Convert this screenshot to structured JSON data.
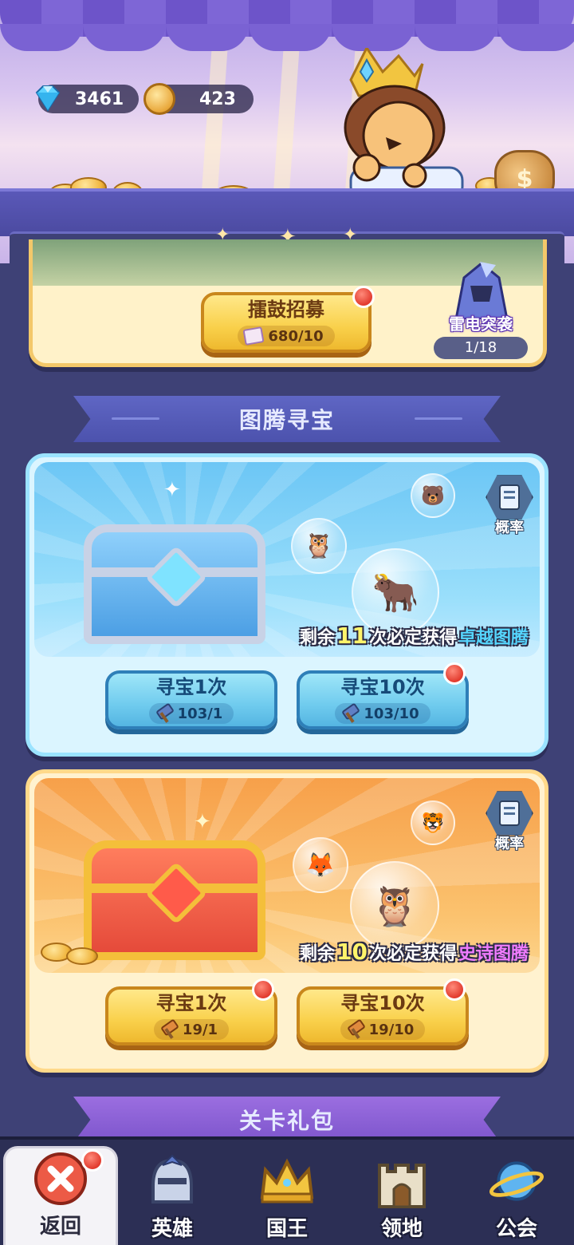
{
  "currencies": {
    "gems": "3461",
    "coins": "423"
  },
  "recruit": {
    "button_title": "擂鼓招募",
    "cost": "680/10",
    "event_title": "雷电突袭",
    "event_progress": "1/18"
  },
  "sections": {
    "totem_title": "图腾寻宝",
    "stage_pack_title": "关卡礼包"
  },
  "totem_blue": {
    "prob_label": "概率",
    "remaining_prefix": "剩余",
    "remaining_count": "11",
    "remaining_mid": "次必定获得",
    "remaining_reward": "卓越图腾",
    "draw1": {
      "title": "寻宝1次",
      "cost": "103/1"
    },
    "draw10": {
      "title": "寻宝10次",
      "cost": "103/10"
    }
  },
  "totem_orange": {
    "prob_label": "概率",
    "remaining_prefix": "剩余",
    "remaining_count": "10",
    "remaining_mid": "次必定获得",
    "remaining_reward": "史诗图腾",
    "draw1": {
      "title": "寻宝1次",
      "cost": "19/1"
    },
    "draw10": {
      "title": "寻宝10次",
      "cost": "19/10"
    }
  },
  "nav": {
    "items": [
      {
        "label": "返回",
        "icon": "close-icon"
      },
      {
        "label": "英雄",
        "icon": "helmet-icon"
      },
      {
        "label": "国王",
        "icon": "crown-icon"
      },
      {
        "label": "领地",
        "icon": "castle-icon"
      },
      {
        "label": "公会",
        "icon": "planet-icon"
      }
    ]
  },
  "colors": {
    "background": "#3e4176",
    "gold_button": "#f9d04a",
    "blue_button": "#6fcbee",
    "notification": "#e23b2e"
  }
}
